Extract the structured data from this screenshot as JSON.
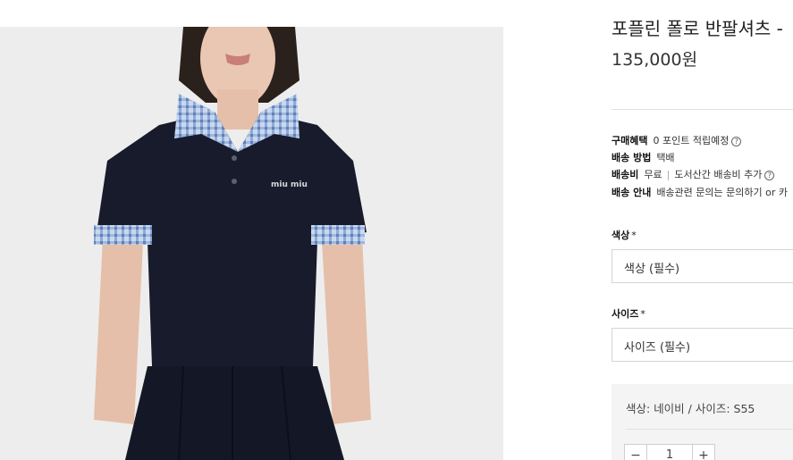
{
  "product": {
    "title": "포플린 폴로 반팔셔츠 -",
    "price": "135,000원",
    "image_text": "miu miu"
  },
  "info": {
    "benefit_label": "구매혜택",
    "benefit_value": "0 포인트 적립예정",
    "shipping_method_label": "배송 방법",
    "shipping_method_value": "택배",
    "shipping_fee_label": "배송비",
    "shipping_fee_value": "무료",
    "shipping_fee_extra": "도서산간 배송비 추가",
    "shipping_guide_label": "배송 안내",
    "shipping_guide_value": "배송관련 문의는 문의하기 or 카"
  },
  "options": {
    "color_label": "색상",
    "color_placeholder": "색상 (필수)",
    "size_label": "사이즈",
    "size_placeholder": "사이즈 (필수)",
    "required_mark": "*"
  },
  "selection": {
    "text": "색상: 네이비 / 사이즈: S55",
    "quantity": "1",
    "minus": "−",
    "plus": "+"
  },
  "icons": {
    "help": "?"
  }
}
